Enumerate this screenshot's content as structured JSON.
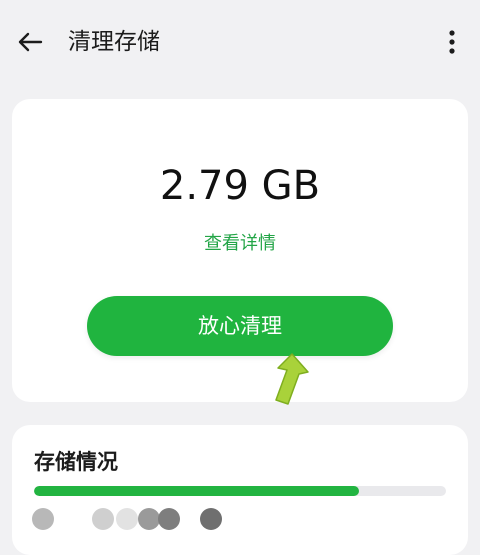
{
  "header": {
    "title": "清理存储",
    "back_icon": "back-arrow-icon",
    "more_icon": "more-vert-icon"
  },
  "summary": {
    "size": "2.79 GB",
    "details_link": "查看详情",
    "clean_button": "放心清理"
  },
  "storage": {
    "title": "存储情况",
    "used_percent": 79,
    "bar_color": "#22b441"
  },
  "colors": {
    "accent": "#20b43f",
    "link": "#23a547",
    "background": "#f1f1f3"
  }
}
